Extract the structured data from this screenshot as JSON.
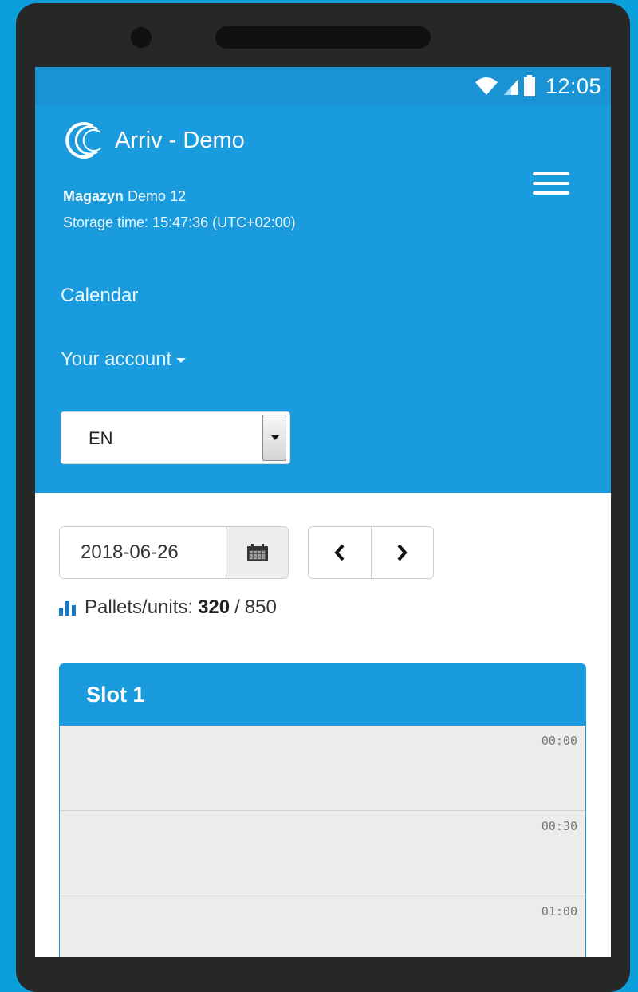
{
  "status_bar": {
    "time": "12:05",
    "icons": [
      "wifi-icon",
      "signal-icon",
      "battery-icon"
    ]
  },
  "header": {
    "app_title": "Arriv - Demo",
    "warehouse_label": "Magazyn",
    "warehouse_name": "Demo 12",
    "storage_time": "Storage time: 15:47:36 (UTC+02:00)",
    "menu_items": [
      {
        "label": "Calendar"
      },
      {
        "label": "Your account"
      }
    ],
    "language": {
      "selected": "EN"
    }
  },
  "toolbar": {
    "date_value": "2018-06-26",
    "prev_icon": "chevron-left-icon",
    "next_icon": "chevron-right-icon"
  },
  "pallets": {
    "label": "Pallets/units:",
    "used": "320",
    "separator": "/",
    "total": "850"
  },
  "slot": {
    "title": "Slot 1",
    "times": [
      "00:00",
      "00:30",
      "01:00"
    ]
  },
  "colors": {
    "background": "#0b9fdc",
    "header": "#1a9bdd",
    "status_bar": "#1993d4",
    "phone_frame": "#272727",
    "slot_body": "#ececec"
  }
}
